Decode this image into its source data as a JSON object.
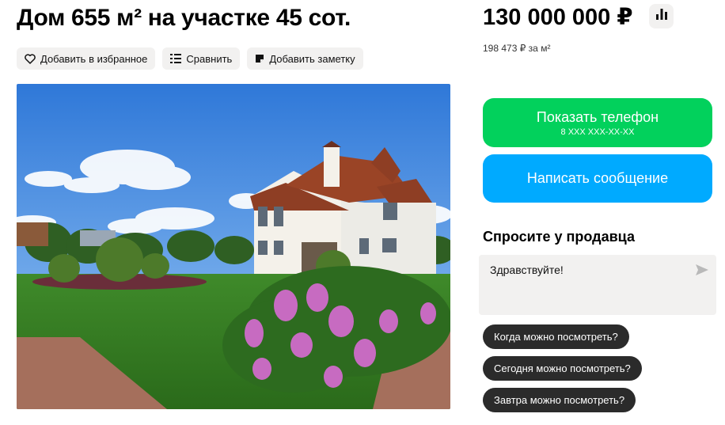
{
  "listing": {
    "title": "Дом 655 м² на участке 45 сот.",
    "price": "130 000 000 ₽",
    "price_per_m2": "198 473 ₽ за м²"
  },
  "actions": {
    "favorite": "Добавить в избранное",
    "compare": "Сравнить",
    "note": "Добавить заметку"
  },
  "contact": {
    "phone_label": "Показать телефон",
    "phone_masked": "8 XXX XXX-XX-XX",
    "message_label": "Написать сообщение"
  },
  "ask": {
    "title": "Спросите у продавца",
    "message_value": "Здравствуйте!",
    "questions": [
      "Когда можно посмотреть?",
      "Сегодня можно посмотреть?",
      "Завтра можно посмотреть?"
    ]
  },
  "colors": {
    "phone_button": "#02d15c",
    "message_button": "#00aaff",
    "pill_bg": "#f2f1f0",
    "question_bg": "#2b2b2b"
  },
  "icons": [
    "heart-icon",
    "compare-icon",
    "note-icon",
    "chart-icon",
    "send-icon"
  ]
}
